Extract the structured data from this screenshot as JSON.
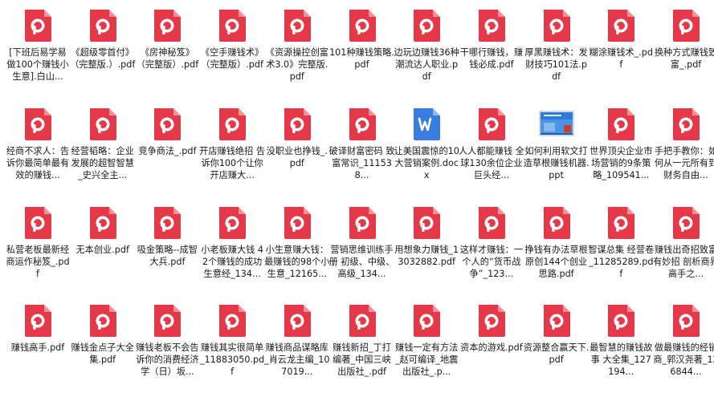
{
  "colors": {
    "pdf": "#e5394a",
    "docx": "#3a7de0",
    "ppt_frame": "#2d7bd6",
    "ppt_accent": "#c8402a"
  },
  "files": [
    {
      "label": "[下班后易学易做100个赚钱小生意].白山...",
      "icon": "pdf-icon"
    },
    {
      "label": "《超级零首付》（完整版.）.pdf",
      "icon": "pdf-icon"
    },
    {
      "label": "《房神秘笈》（完整版）.pdf",
      "icon": "pdf-icon"
    },
    {
      "label": "《空手赚钱术》（完整版）.pdf",
      "icon": "pdf-icon"
    },
    {
      "label": "《资源操控创富术3.0》完整版.pdf",
      "icon": "pdf-icon"
    },
    {
      "label": "101种赚钱策略.pdf",
      "icon": "pdf-icon"
    },
    {
      "label": "边玩边赚钱36种潮流达人职业.pdf",
      "icon": "pdf-icon"
    },
    {
      "label": "干哪行赚钱，赚钱必成.pdf",
      "icon": "pdf-icon"
    },
    {
      "label": "厚黑赚钱术：发财技巧101法.pdf",
      "icon": "pdf-icon"
    },
    {
      "label": "糊涂赚钱术_.pdf",
      "icon": "pdf-icon"
    },
    {
      "label": "换种方式赚钱致富_.pdf",
      "icon": "pdf-icon"
    },
    {
      "label": "经商不求人：告诉你最简单最有效的赚钱...",
      "icon": "pdf-icon"
    },
    {
      "label": "经营韬略：企业发展的超智智慧_史兴全主...",
      "icon": "pdf-icon"
    },
    {
      "label": "竞争商法_.pdf",
      "icon": "pdf-icon"
    },
    {
      "label": "开店赚钱绝招 告诉你100个让你开店赚大...",
      "icon": "pdf-icon"
    },
    {
      "label": "没职业也挣钱_.pdf",
      "icon": "pdf-icon"
    },
    {
      "label": "破译财富密码 致富常识_111538...",
      "icon": "pdf-icon"
    },
    {
      "label": "让美国震惊的10大营销案例.docx",
      "icon": "docx-icon"
    },
    {
      "label": "人人都能赚钱 全球130余位企业巨头经...",
      "icon": "pdf-icon"
    },
    {
      "label": "如何利用软文打造草根赚钱机器.ppt",
      "icon": "ppt-icon"
    },
    {
      "label": "世界顶尖企业市场营销的9条策略_109541...",
      "icon": "pdf-icon"
    },
    {
      "label": "手把手教你：如何从一元所有到财务自由...",
      "icon": "pdf-icon"
    },
    {
      "label": "私营老板最新经商运作秘笈_.pdf",
      "icon": "pdf-icon"
    },
    {
      "label": "无本创业.pdf",
      "icon": "pdf-icon"
    },
    {
      "label": "吸金策略--成智大兵.pdf",
      "icon": "pdf-icon"
    },
    {
      "label": "小老板赚大钱 42个赚钱的成功生意经_134...",
      "icon": "pdf-icon"
    },
    {
      "label": "小生意赚大钱：最赚钱的98个小生意_12165...",
      "icon": "pdf-icon"
    },
    {
      "label": "营销思维训练手册 初级、中级、高级_134...",
      "icon": "pdf-icon"
    },
    {
      "label": "用想象力赚钱_13032882.pdf",
      "icon": "pdf-icon"
    },
    {
      "label": "这样才赚钱：一个人的“货币战争”_123...",
      "icon": "pdf-icon"
    },
    {
      "label": "挣钱有办法草根原创144个创业思路.pdf",
      "icon": "pdf-icon"
    },
    {
      "label": "智谋总集 经营卷_11285289.pdf",
      "icon": "pdf-icon"
    },
    {
      "label": "赚钱出奇招致富有妙招 剖析商界高手之...",
      "icon": "pdf-icon"
    },
    {
      "label": "赚钱高手.pdf",
      "icon": "pdf-icon"
    },
    {
      "label": "赚钱金点子大全集.pdf",
      "icon": "pdf-icon"
    },
    {
      "label": "赚钱老板不会告诉你的消费经济学（日）坂...",
      "icon": "pdf-icon"
    },
    {
      "label": "赚钱其实很简单_11883050.pdf",
      "icon": "pdf-icon"
    },
    {
      "label": "赚钱商品谋略库_肖云龙主编_107019...",
      "icon": "pdf-icon"
    },
    {
      "label": "赚钱新招_丁打编著_中国三峡出版社_.pdf",
      "icon": "pdf-icon"
    },
    {
      "label": "赚钱一定有方法_赵可编译_地震出版社_.p...",
      "icon": "pdf-icon"
    },
    {
      "label": "资本的游戏.pdf",
      "icon": "pdf-icon"
    },
    {
      "label": "资源整合赢天下.pdf",
      "icon": "pdf-icon"
    },
    {
      "label": "最智慧的赚钱故事 大全集_127194...",
      "icon": "pdf-icon"
    },
    {
      "label": "做最赚钱的经销商_郭汉尧著_126844...",
      "icon": "pdf-icon"
    }
  ]
}
